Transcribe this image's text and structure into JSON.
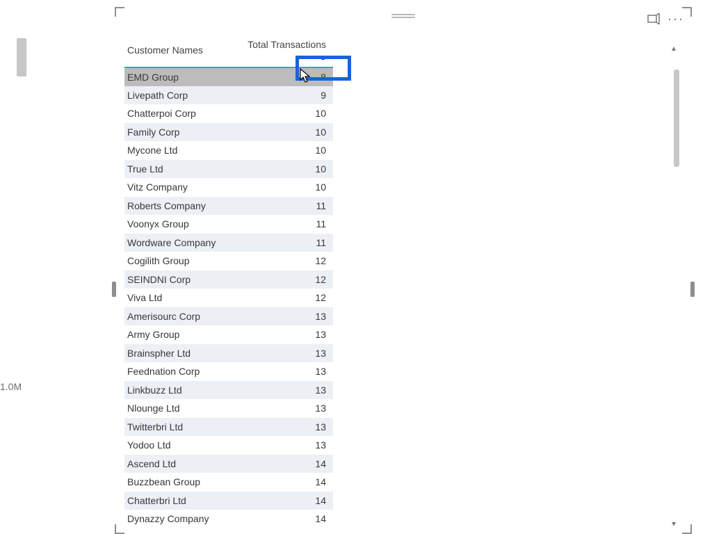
{
  "left_axis_tick": "1.0M",
  "table": {
    "columns": {
      "name": "Customer Names",
      "value": "Total Transactions"
    },
    "sort_indicator": "▲",
    "rows": [
      {
        "name": "EMD Group",
        "value": "8"
      },
      {
        "name": "Livepath Corp",
        "value": "9"
      },
      {
        "name": "Chatterpoi Corp",
        "value": "10"
      },
      {
        "name": "Family Corp",
        "value": "10"
      },
      {
        "name": "Mycone Ltd",
        "value": "10"
      },
      {
        "name": "True Ltd",
        "value": "10"
      },
      {
        "name": "Vitz Company",
        "value": "10"
      },
      {
        "name": "Roberts Company",
        "value": "11"
      },
      {
        "name": "Voonyx Group",
        "value": "11"
      },
      {
        "name": "Wordware Company",
        "value": "11"
      },
      {
        "name": "Cogilith Group",
        "value": "12"
      },
      {
        "name": "SEINDNI Corp",
        "value": "12"
      },
      {
        "name": "Viva Ltd",
        "value": "12"
      },
      {
        "name": "Amerisourc Corp",
        "value": "13"
      },
      {
        "name": "Army Group",
        "value": "13"
      },
      {
        "name": "Brainspher Ltd",
        "value": "13"
      },
      {
        "name": "Feednation Corp",
        "value": "13"
      },
      {
        "name": "Linkbuzz Ltd",
        "value": "13"
      },
      {
        "name": "Nlounge Ltd",
        "value": "13"
      },
      {
        "name": "Twitterbri Ltd",
        "value": "13"
      },
      {
        "name": "Yodoo Ltd",
        "value": "13"
      },
      {
        "name": "Ascend Ltd",
        "value": "14"
      },
      {
        "name": "Buzzbean Group",
        "value": "14"
      },
      {
        "name": "Chatterbri Ltd",
        "value": "14"
      },
      {
        "name": "Dynazzy Company",
        "value": "14"
      }
    ]
  }
}
